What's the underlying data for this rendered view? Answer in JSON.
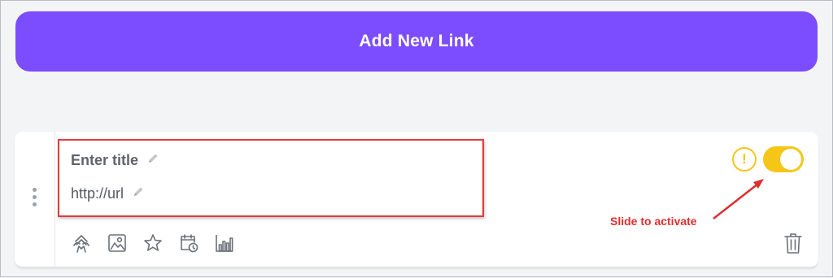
{
  "add_button": {
    "label": "Add New Link"
  },
  "link_card": {
    "title_placeholder": "Enter title",
    "url_placeholder": "http://url",
    "toolbar_icons": [
      "redirect-icon",
      "image-icon",
      "star-icon",
      "calendar-clock-icon",
      "analytics-icon"
    ],
    "warning_symbol": "!",
    "toggle_active": true
  },
  "annotation": {
    "text": "Slide to activate"
  },
  "colors": {
    "accent": "#7c4dff",
    "toggle": "#f5c518",
    "highlight": "#e23b3b",
    "annotation": "#e02d2d"
  }
}
